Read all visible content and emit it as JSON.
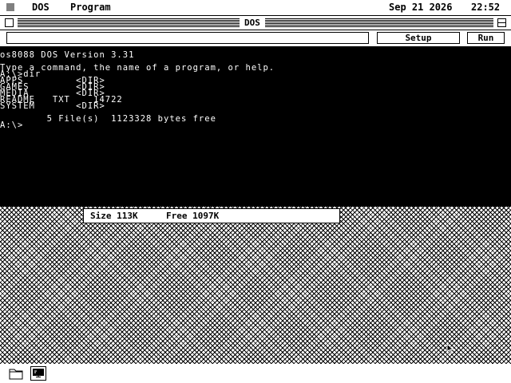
{
  "menubar": {
    "items": [
      {
        "label": "DOS"
      },
      {
        "label": "Program"
      }
    ],
    "date": "Sep 21 2026",
    "time": "22:52"
  },
  "window": {
    "title": "DOS"
  },
  "toolbar": {
    "command_value": "",
    "setup_label": "Setup",
    "run_label": "Run"
  },
  "console": {
    "lines": [
      "os8088 DOS Version 3.31",
      "",
      "Type a command, the name of a program, or help.",
      "A:\\>dir",
      "APPS         <DIR>",
      "GAMES        <DIR>",
      "MEDIA        <DIR>",
      "README   TXT    14722",
      "SYSTEM       <DIR>",
      "",
      "        5 File(s)  1123328 bytes free",
      "",
      "A:\\>"
    ]
  },
  "status": {
    "size": "Size 113K",
    "free": "Free 1097K"
  },
  "dock": {
    "items": [
      {
        "icon": "folder-icon"
      },
      {
        "icon": "monitor-icon"
      }
    ]
  }
}
